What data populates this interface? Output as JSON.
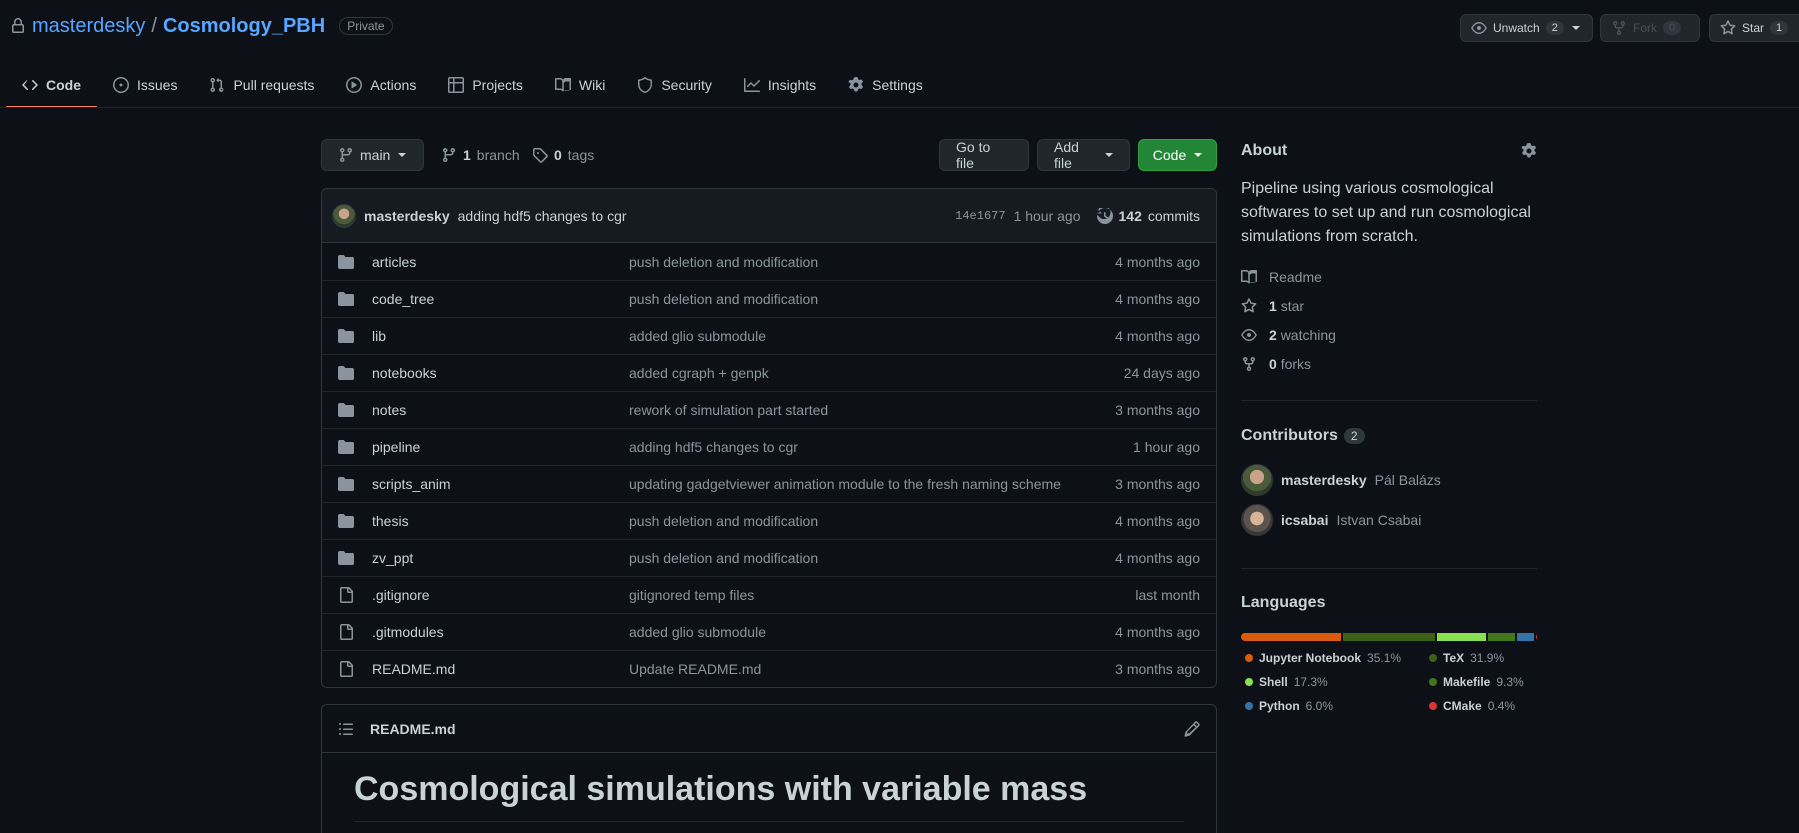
{
  "repo": {
    "owner": "masterdesky",
    "separator": "/",
    "name": "Cosmology_PBH",
    "visibility": "Private"
  },
  "header_actions": {
    "unwatch": {
      "label": "Unwatch",
      "count": "2"
    },
    "fork": {
      "label": "Fork",
      "count": "0"
    },
    "star": {
      "label": "Star",
      "count": "1"
    }
  },
  "tabs": [
    {
      "label": "Code",
      "icon": "code-icon"
    },
    {
      "label": "Issues",
      "icon": "issue-icon"
    },
    {
      "label": "Pull requests",
      "icon": "pull-request-icon"
    },
    {
      "label": "Actions",
      "icon": "play-icon"
    },
    {
      "label": "Projects",
      "icon": "table-icon"
    },
    {
      "label": "Wiki",
      "icon": "book-icon"
    },
    {
      "label": "Security",
      "icon": "shield-icon"
    },
    {
      "label": "Insights",
      "icon": "graph-icon"
    },
    {
      "label": "Settings",
      "icon": "gear-icon"
    }
  ],
  "toolbar": {
    "branch": "main",
    "branches_count": "1",
    "branches_label": "branch",
    "tags_count": "0",
    "tags_label": "tags",
    "go_to_file": "Go to file",
    "add_file": "Add file",
    "code": "Code"
  },
  "commit": {
    "author": "masterdesky",
    "message": "adding hdf5 changes to cgr",
    "sha": "14e1677",
    "time": "1 hour ago",
    "commits_count": "142",
    "commits_label": "commits"
  },
  "files": [
    {
      "type": "dir",
      "name": "articles",
      "message": "push deletion and modification",
      "age": "4 months ago"
    },
    {
      "type": "dir",
      "name": "code_tree",
      "message": "push deletion and modification",
      "age": "4 months ago"
    },
    {
      "type": "dir",
      "name": "lib",
      "message": "added glio submodule",
      "age": "4 months ago"
    },
    {
      "type": "dir",
      "name": "notebooks",
      "message": "added cgraph + genpk",
      "age": "24 days ago"
    },
    {
      "type": "dir",
      "name": "notes",
      "message": "rework of simulation part started",
      "age": "3 months ago"
    },
    {
      "type": "dir",
      "name": "pipeline",
      "message": "adding hdf5 changes to cgr",
      "age": "1 hour ago"
    },
    {
      "type": "dir",
      "name": "scripts_anim",
      "message": "updating gadgetviewer animation module to the fresh naming scheme",
      "age": "3 months ago"
    },
    {
      "type": "dir",
      "name": "thesis",
      "message": "push deletion and modification",
      "age": "4 months ago"
    },
    {
      "type": "dir",
      "name": "zv_ppt",
      "message": "push deletion and modification",
      "age": "4 months ago"
    },
    {
      "type": "file",
      "name": ".gitignore",
      "message": "gitignored temp files",
      "age": "last month"
    },
    {
      "type": "file",
      "name": ".gitmodules",
      "message": "added glio submodule",
      "age": "4 months ago"
    },
    {
      "type": "file",
      "name": "README.md",
      "message": "Update README.md",
      "age": "3 months ago"
    }
  ],
  "readme": {
    "filename": "README.md",
    "heading": "Cosmological simulations with variable mass"
  },
  "about": {
    "title": "About",
    "description": "Pipeline using various cosmological softwares to set up and run cosmological simulations from scratch.",
    "readme_label": "Readme",
    "stars_count": "1",
    "stars_label": "star",
    "watching_count": "2",
    "watching_label": "watching",
    "forks_count": "0",
    "forks_label": "forks"
  },
  "contributors": {
    "title": "Contributors",
    "count": "2",
    "people": [
      {
        "login": "masterdesky",
        "name": "Pál Balázs"
      },
      {
        "login": "icsabai",
        "name": "Istvan Csabai"
      }
    ]
  },
  "languages": {
    "title": "Languages",
    "items": [
      {
        "name": "Jupyter Notebook",
        "percent": "35.1%",
        "value": 35.1,
        "color": "#DA5B0B"
      },
      {
        "name": "TeX",
        "percent": "31.9%",
        "value": 31.9,
        "color": "#3D6117"
      },
      {
        "name": "Shell",
        "percent": "17.3%",
        "value": 17.3,
        "color": "#89e051"
      },
      {
        "name": "Makefile",
        "percent": "9.3%",
        "value": 9.3,
        "color": "#427819"
      },
      {
        "name": "Python",
        "percent": "6.0%",
        "value": 6.0,
        "color": "#3572A5"
      },
      {
        "name": "CMake",
        "percent": "0.4%",
        "value": 0.4,
        "color": "#DA3434"
      }
    ]
  },
  "colors": {
    "accent": "#58a6ff",
    "tab_underline": "#f78166",
    "primary_button": "#238636"
  }
}
